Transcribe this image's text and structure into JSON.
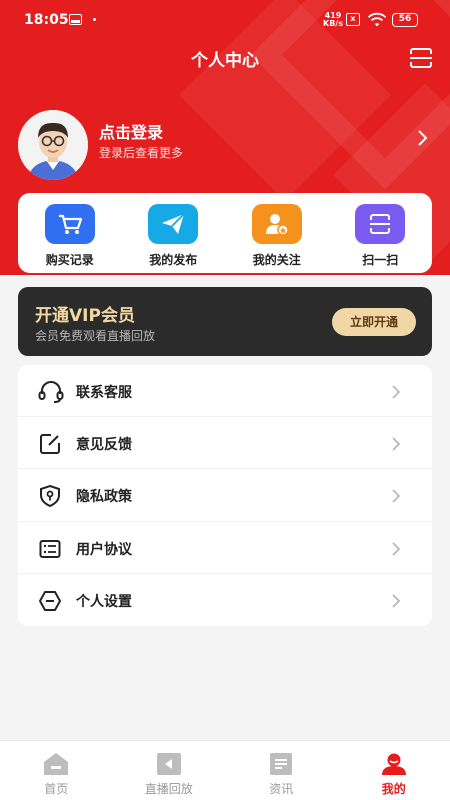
{
  "status_bar": {
    "time": "18:05",
    "net_speed_top": "419",
    "net_speed_bottom": "KB/s",
    "sim": "x",
    "battery": "56"
  },
  "header": {
    "title": "个人中心"
  },
  "user": {
    "login_title": "点击登录",
    "login_subtitle": "登录后查看更多"
  },
  "quick_actions": [
    {
      "label": "购买记录",
      "icon": "cart-icon",
      "color": "#2f6ff0"
    },
    {
      "label": "我的发布",
      "icon": "paper-plane-icon",
      "color": "#17a8e6"
    },
    {
      "label": "我的关注",
      "icon": "user-follow-icon",
      "color": "#f5921e"
    },
    {
      "label": "扫一扫",
      "icon": "scan-icon",
      "color": "#7a5cf0"
    }
  ],
  "vip": {
    "title": "开通VIP会员",
    "subtitle": "会员免费观看直播回放",
    "button": "立即开通"
  },
  "menu": [
    {
      "label": "联系客服",
      "icon": "headset-icon"
    },
    {
      "label": "意见反馈",
      "icon": "feedback-icon"
    },
    {
      "label": "隐私政策",
      "icon": "shield-icon"
    },
    {
      "label": "用户协议",
      "icon": "agreement-icon"
    },
    {
      "label": "个人设置",
      "icon": "settings-icon"
    }
  ],
  "tabs": [
    {
      "label": "首页",
      "icon": "home-icon",
      "active": false
    },
    {
      "label": "直播回放",
      "icon": "playback-icon",
      "active": false
    },
    {
      "label": "资讯",
      "icon": "news-icon",
      "active": false
    },
    {
      "label": "我的",
      "icon": "profile-icon",
      "active": true
    }
  ],
  "colors": {
    "primary": "#e41e1e",
    "vip_bg": "#2b2b2b",
    "vip_gold": "#f3d8a2"
  }
}
